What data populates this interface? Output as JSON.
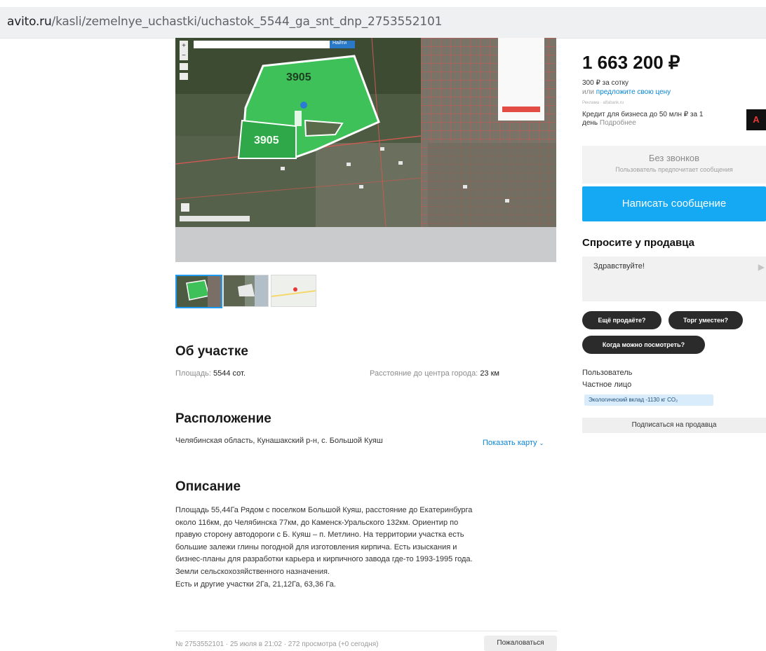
{
  "browser": {
    "url_host": "avito.ru",
    "url_path": "/kasli/zemelnye_uchastki/uchastok_5544_ga_snt_dnp_2753552101"
  },
  "map": {
    "parcel_label_1": "3905",
    "parcel_label_2": "3905",
    "search_button": "Найти"
  },
  "listing": {
    "about_title": "Об участке",
    "area_label": "Площадь:",
    "area_value": "5544 сот.",
    "distance_label": "Расстояние до центра города:",
    "distance_value": "23 км",
    "location_title": "Расположение",
    "address": "Челябинская область, Кунашакский р-н, с. Большой Куяш",
    "show_map": "Показать карту",
    "description_title": "Описание",
    "description_lines": [
      "Площадь 55,44Га Рядом с поселком Большой Куяш, расстояние до Екатеринбурга",
      "около 116км, до Челябинска 77км, до Каменск-Уральского 132км. Ориентир по",
      "правую сторону автодороги с Б. Куяш – п. Метлино. На территории участка есть",
      "большие залежи глины погодной для изготовления кирпича. Есть изыскания и",
      "бизнес-планы для разработки карьера и кирпичного завода где-то 1993-1995 года.",
      "Земли сельскохозяйственного назначения.",
      "Есть и другие участки 2Га, 21,12Га, 63,36 Га."
    ],
    "footer_meta": "№ 2753552101 · 25 июля в 21:02 · 272 просмотра (+0 сегодня)",
    "complain_button": "Пожаловаться"
  },
  "sidebar": {
    "price": "1 663 200 ₽",
    "price_per": "300 ₽ за сотку",
    "offer_prefix": "или ",
    "offer_link": "предложите свою цену",
    "ad_small": "Реклама · alfabank.ru",
    "credit_text_1": "Кредит для бизнеса до 50 млн ₽ за 1",
    "credit_text_2": "день ",
    "credit_more": "Подробнее",
    "ad_badge": "А",
    "no_calls": "Без звонков",
    "no_calls_sub": "Пользователь предпочитает сообщения",
    "write_message": "Написать сообщение",
    "ask_seller": "Спросите у продавца",
    "ask_placeholder": "Здравствуйте!",
    "chips": [
      "Ещё продаёте?",
      "Торг уместен?",
      "Когда можно посмотреть?"
    ],
    "seller_name": "Пользователь",
    "seller_type": "Частное лицо",
    "eco": "Экологический вклад -1130 кг CO₂",
    "subscribe": "Подписаться на продавца"
  }
}
